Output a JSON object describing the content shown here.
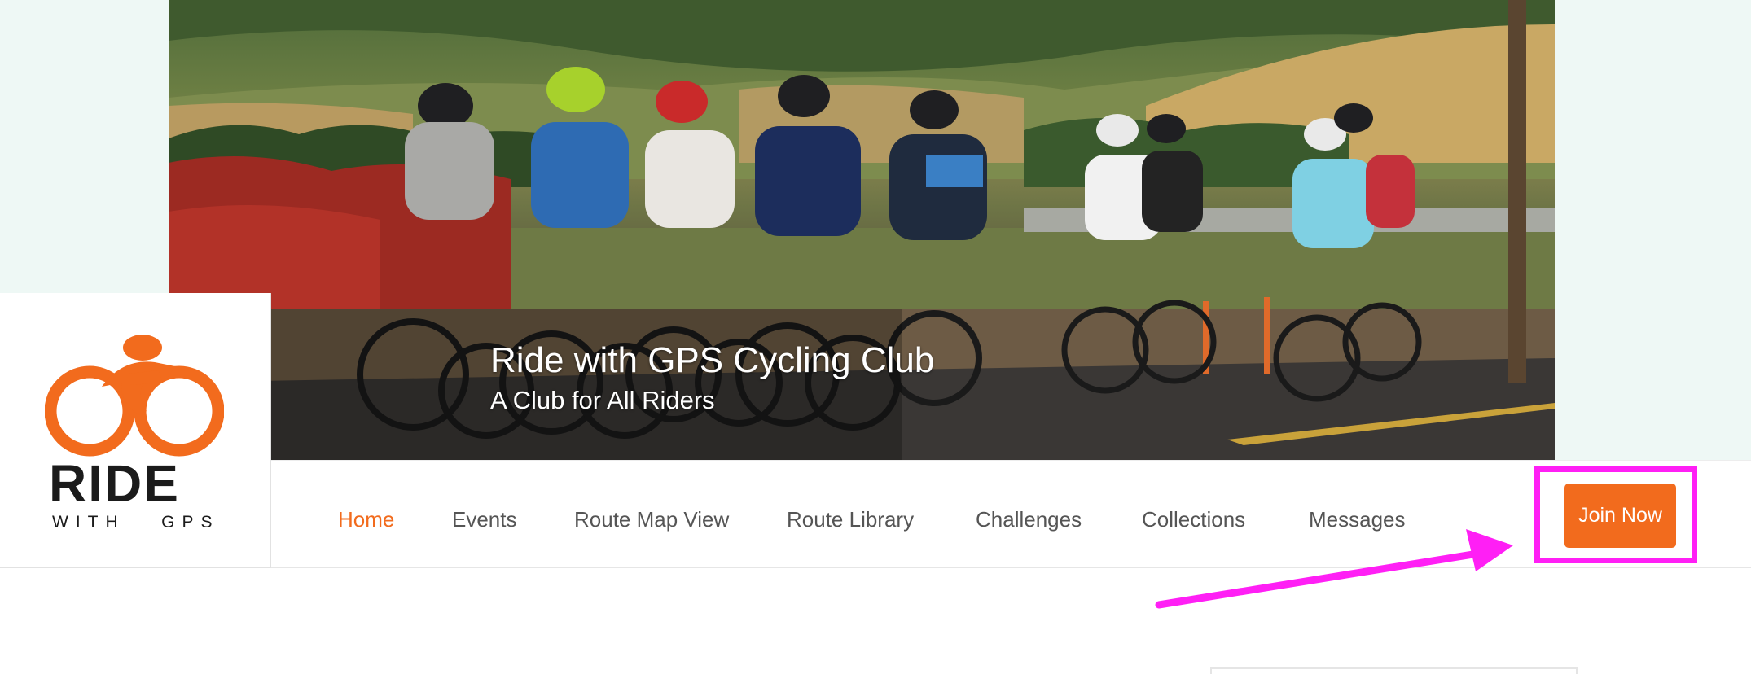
{
  "club": {
    "title": "Ride with GPS Cycling Club",
    "subtitle": "A Club for All Riders"
  },
  "logo": {
    "word": "RIDE",
    "sub": "WITH   GPS",
    "icon": "cyclist-logo-icon",
    "accent_color": "#f26b1d"
  },
  "nav": {
    "items": [
      {
        "label": "Home",
        "active": true
      },
      {
        "label": "Events",
        "active": false
      },
      {
        "label": "Route Map View",
        "active": false
      },
      {
        "label": "Route Library",
        "active": false
      },
      {
        "label": "Challenges",
        "active": false
      },
      {
        "label": "Collections",
        "active": false
      },
      {
        "label": "Messages",
        "active": false
      }
    ],
    "active_color": "#f26b1d"
  },
  "join": {
    "label": "Join Now",
    "color": "#f26b1d"
  },
  "annotation": {
    "color": "#ff1ff5",
    "shape": "highlight-box-and-arrow"
  }
}
